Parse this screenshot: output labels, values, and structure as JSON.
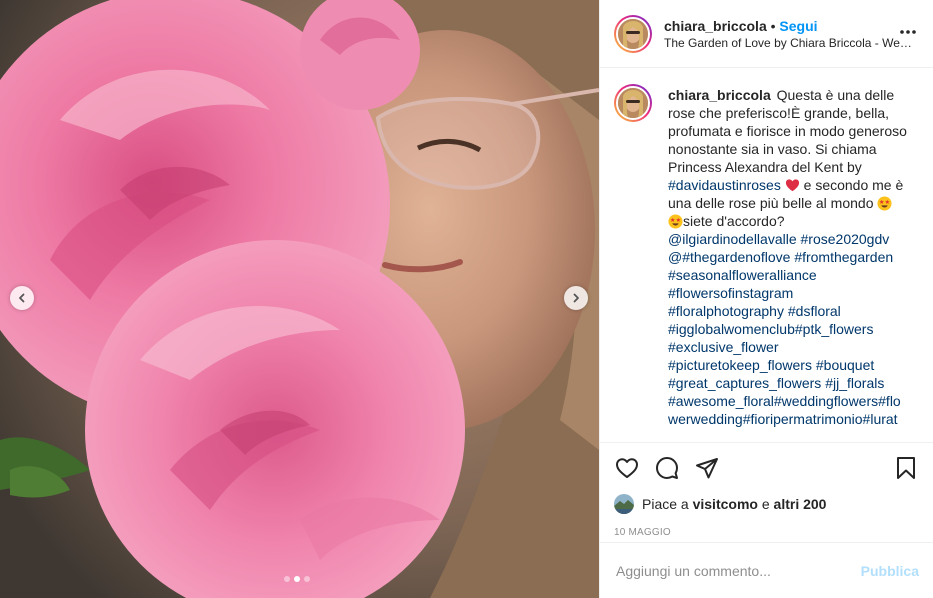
{
  "header": {
    "username": "chiara_briccola",
    "separator": "•",
    "follow_label": "Segui",
    "location": "The Garden of Love by Chiara Briccola - Wedd...",
    "more_icon": "more-options-icon"
  },
  "caption": {
    "username": "chiara_briccola",
    "text_1": "Questa è una delle rose che preferisco!È grande, bella, profumata e fiorisce in modo generoso nonostante sia in vaso. Si chiama Princess Alexandra del Kent by ",
    "tag_1": "#davidaustinroses",
    "emoji_1": "red-heart-emoji",
    "text_2": " e secondo me è una delle rose più belle al mondo ",
    "emoji_2": "star-struck-emoji",
    "emoji_3": "star-struck-emoji",
    "text_3": "siete d'accordo?",
    "tags": [
      "@ilgiardinodellavalle",
      "#rose2020gdv",
      "@#thegardenoflove",
      "#fromthegarden",
      "#seasonalfloweralliance",
      "#flowersofinstagram",
      "#floralphotography",
      "#dsfloral",
      "#igglobalwomenclub",
      "#ptk_flowers",
      "#exclusive_flower",
      "#picturetokeep_flowers",
      "#bouquet",
      "#great_captures_flowers",
      "#jj_florals",
      "#awesome_floral",
      "#weddingflowers",
      "#flowerwedding",
      "#fioripermatrimonio",
      "#lurat"
    ]
  },
  "actions": {
    "like_icon": "heart-icon",
    "comment_icon": "comment-icon",
    "share_icon": "share-icon",
    "save_icon": "bookmark-icon"
  },
  "likes": {
    "prefix": "Piace a ",
    "user": "visitcomo",
    "middle": " e ",
    "others": "altri 200"
  },
  "date": "10 MAGGIO",
  "comment_box": {
    "placeholder": "Aggiungi un commento...",
    "publish_label": "Pubblica"
  },
  "carousel": {
    "total_slides": 3,
    "active_slide": 2,
    "prev_icon": "chevron-left-icon",
    "next_icon": "chevron-right-icon"
  },
  "colors": {
    "link": "#00376b",
    "follow": "#0095f6",
    "publish_disabled": "#b2dffc",
    "muted": "#8e8e8e"
  }
}
